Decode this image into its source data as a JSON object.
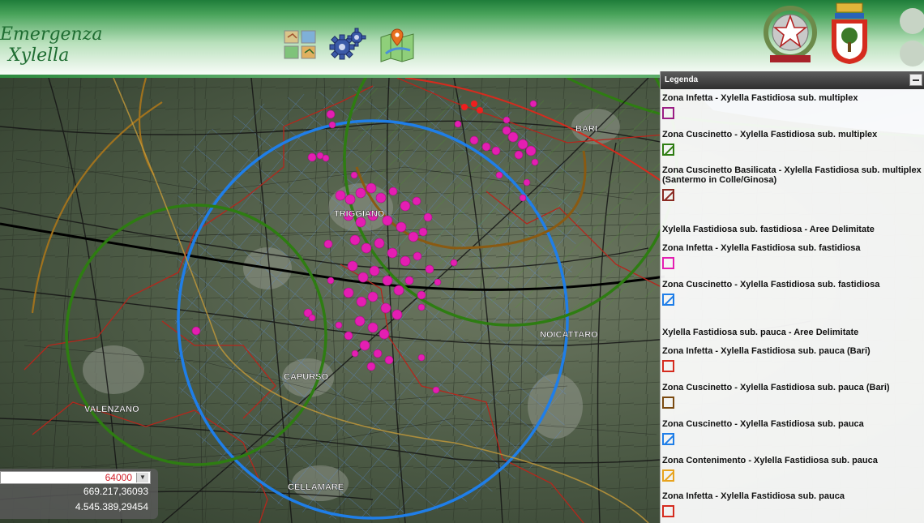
{
  "app": {
    "title_line1": "Emergenza",
    "title_line2": "Xylella"
  },
  "toolbar": {
    "icons": [
      "layers-icon",
      "gear-icon",
      "map-marker-icon"
    ]
  },
  "colors": {
    "green": "#2e7d12",
    "blue": "#1f7ee8",
    "brown": "#8a5a12",
    "magenta": "#e41eb2",
    "red": "#d52b1e",
    "yellow": "#e8a31e",
    "purple": "#9a1d84",
    "road": "#1b1b1b"
  },
  "map": {
    "place_labels": [
      "BARI",
      "TRIGGIANO",
      "NOICATTARO",
      "CAPURSO",
      "VALENZANO",
      "CELLAMARE"
    ]
  },
  "coords": {
    "scale": "64000",
    "x": "669.217,36093",
    "y": "4.545.389,29454"
  },
  "legend": {
    "title": "Legenda",
    "items": [
      {
        "label": "Zona Infetta - Xylella Fastidiosa sub. multiplex",
        "color": "#9a1d84",
        "hatch": false
      },
      {
        "label": "Zona Cuscinetto - Xylella Fastidiosa sub. multiplex",
        "color": "#2e7d12",
        "hatch": true
      },
      {
        "label": "Zona Cuscinetto Basilicata - Xylella Fastidiosa sub. multiplex (Santermo in Colle/Ginosa)",
        "color": "#8a2a22",
        "hatch": true
      },
      {
        "header": "Xylella Fastidiosa sub. fastidiosa - Aree Delimitate"
      },
      {
        "label": "Zona Infetta - Xylella Fastidiosa sub. fastidiosa",
        "color": "#e41eb2",
        "hatch": false
      },
      {
        "label": "Zona Cuscinetto - Xylella Fastidiosa sub. fastidiosa",
        "color": "#1f7ee8",
        "hatch": true
      },
      {
        "header": "Xylella Fastidiosa sub. pauca - Aree Delimitate"
      },
      {
        "label": "Zona Infetta - Xylella Fastidiosa sub. pauca (Bari)",
        "color": "#d52b1e",
        "hatch": false
      },
      {
        "label": "Zona Cuscinetto - Xylella Fastidiosa sub. pauca (Bari)",
        "color": "#7a4a10",
        "hatch": false
      },
      {
        "label": "Zona Cuscinetto - Xylella Fastidiosa sub. pauca",
        "color": "#1f7ee8",
        "hatch": true
      },
      {
        "label": "Zona Contenimento - Xylella Fastidiosa sub. pauca",
        "color": "#e8a31e",
        "hatch": true
      },
      {
        "label": "Zona Infetta - Xylella Fastidiosa sub. pauca",
        "color": "#d52b1e",
        "hatch": false
      }
    ]
  }
}
